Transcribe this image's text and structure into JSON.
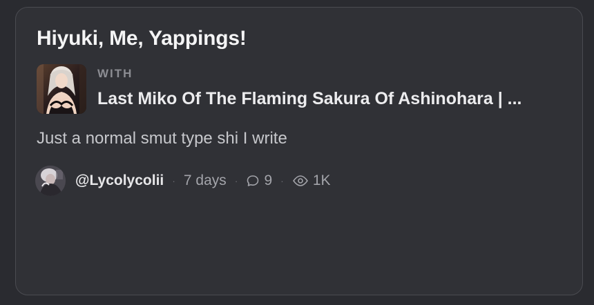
{
  "story": {
    "title": "Hiyuki, Me, Yappings!",
    "with_label": "WITH",
    "character_name": "Last Miko Of The Flaming Sakura Of Ashinohara | ...",
    "description": "Just a normal smut type shi I write"
  },
  "meta": {
    "username": "@Lycolycolii",
    "age": "7 days",
    "comments": "9",
    "views": "1K"
  },
  "icons": {
    "comments": "comment-bubble-icon",
    "views": "eye-icon"
  },
  "colors": {
    "page_background": "#2a2b30",
    "card_background": "#303136",
    "card_border": "#4a4b51"
  }
}
